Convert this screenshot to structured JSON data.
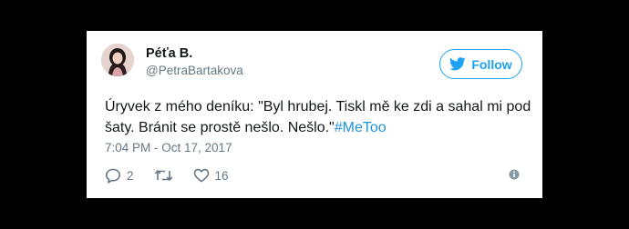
{
  "tweet": {
    "author_name": "Péťa B.",
    "author_handle": "@PetraBartakova",
    "follow_label": "Follow",
    "text": "Úryvek z mého deníku: \"Byl hrubej. Tiskl mě ke zdi a sahal mi pod šaty. Bránit se prostě nešlo. Nešlo.\"",
    "hashtag": "#MeToo",
    "timestamp": "7:04 PM - Oct 17, 2017",
    "reply_count": "2",
    "like_count": "16"
  },
  "colors": {
    "accent": "#1da1f2",
    "hashtag": "#1b95e0",
    "text": "#14171a",
    "secondary": "#657786",
    "background": "#000000",
    "card": "#ffffff"
  },
  "icons": {
    "follow": "twitter-bird-icon",
    "reply": "reply-icon",
    "retweet": "retweet-icon",
    "like": "heart-icon",
    "info": "info-icon"
  }
}
